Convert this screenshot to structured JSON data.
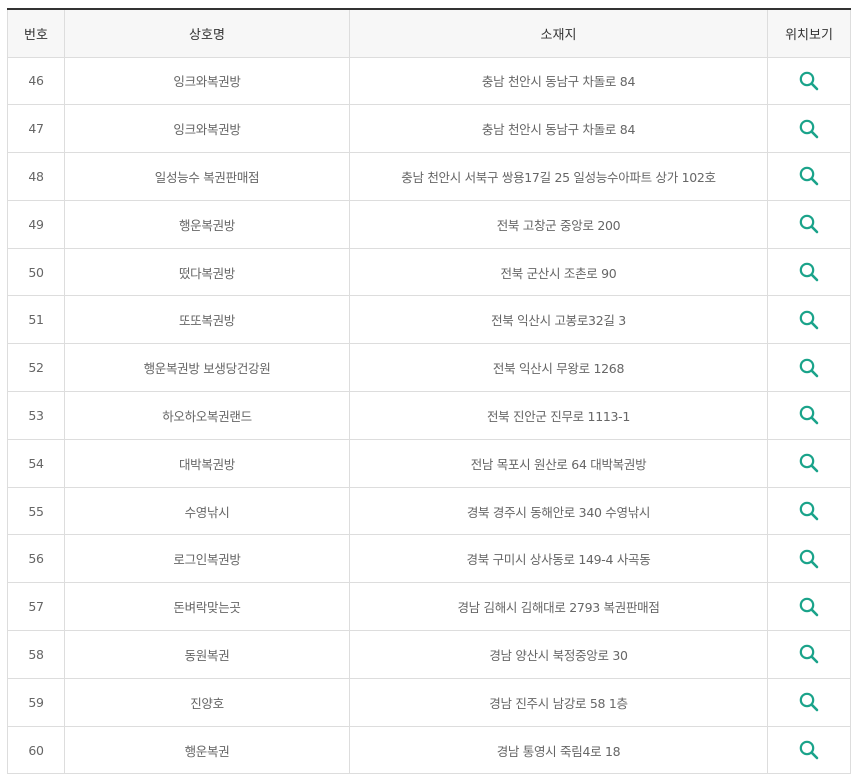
{
  "table": {
    "headers": {
      "number": "번호",
      "name": "상호명",
      "address": "소재지",
      "location": "위치보기"
    },
    "rows": [
      {
        "number": "46",
        "name": "잉크와복권방",
        "address": "충남 천안시 동남구 차돌로 84"
      },
      {
        "number": "47",
        "name": "잉크와복권방",
        "address": "충남 천안시 동남구 차돌로 84"
      },
      {
        "number": "48",
        "name": "일성능수 복권판매점",
        "address": "충남 천안시 서북구 쌍용17길 25 일성능수아파트 상가 102호"
      },
      {
        "number": "49",
        "name": "행운복권방",
        "address": "전북 고창군 중앙로 200"
      },
      {
        "number": "50",
        "name": "떴다복권방",
        "address": "전북 군산시 조촌로 90"
      },
      {
        "number": "51",
        "name": "또또복권방",
        "address": "전북 익산시 고봉로32길 3"
      },
      {
        "number": "52",
        "name": "행운복권방 보생당건강원",
        "address": "전북 익산시 무왕로 1268"
      },
      {
        "number": "53",
        "name": "하오하오복권랜드",
        "address": "전북 진안군 진무로 1113-1"
      },
      {
        "number": "54",
        "name": "대박복권방",
        "address": "전남 목포시 원산로 64 대박복권방"
      },
      {
        "number": "55",
        "name": "수영낚시",
        "address": "경북 경주시 동해안로 340 수영낚시"
      },
      {
        "number": "56",
        "name": "로그인복권방",
        "address": "경북 구미시 상사동로 149-4 사곡동"
      },
      {
        "number": "57",
        "name": "돈벼락맞는곳",
        "address": "경남 김해시 김해대로 2793 복권판매점"
      },
      {
        "number": "58",
        "name": "동원복권",
        "address": "경남 양산시 북정중앙로 30"
      },
      {
        "number": "59",
        "name": "진양호",
        "address": "경남 진주시 남강로 58 1층"
      },
      {
        "number": "60",
        "name": "행운복권",
        "address": "경남 통영시 죽림4로 18"
      }
    ]
  },
  "icons": {
    "location": "search-icon"
  },
  "colors": {
    "accent": "#1aa38a",
    "header_border": "#333333",
    "header_bg": "#f7f7f7",
    "grid": "#dddddd"
  }
}
